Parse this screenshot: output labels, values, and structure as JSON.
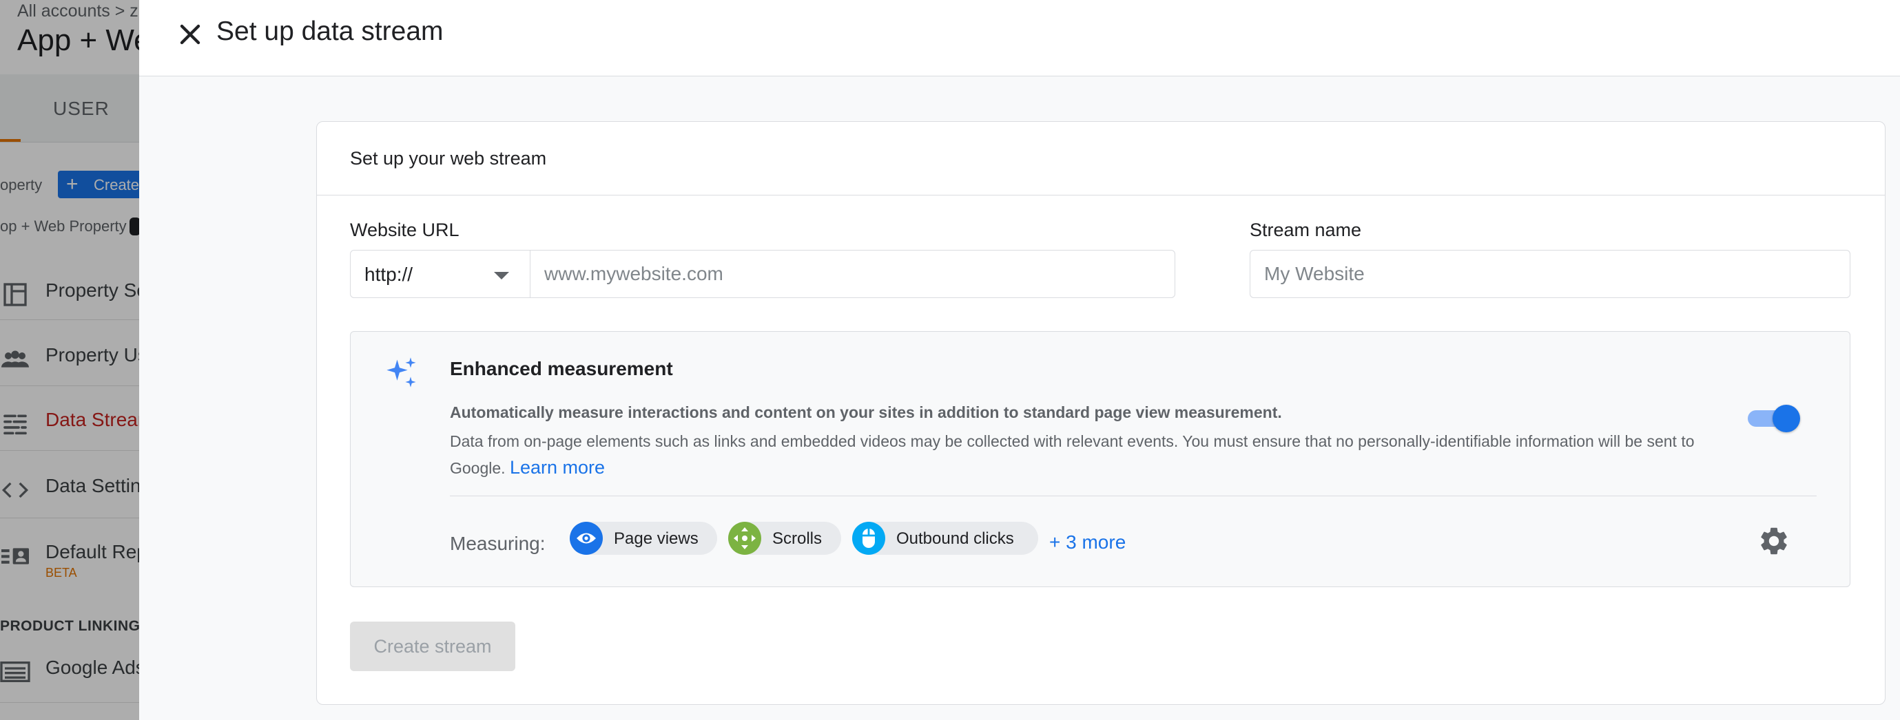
{
  "background": {
    "breadcrumb": "All accounts > z",
    "page_title": "App + We",
    "tab_label": "USER",
    "property_label": "operty",
    "create_label": "Create",
    "property_name": "op + Web Property",
    "nav_items": [
      {
        "label": "Property Se",
        "icon": "layout-icon",
        "active": false
      },
      {
        "label": "Property Us",
        "icon": "people-icon",
        "active": false
      },
      {
        "label": "Data Stream",
        "icon": "data-streams-icon",
        "active": true
      },
      {
        "label": "Data Setting",
        "icon": "code-icon",
        "active": false
      },
      {
        "label": "Default Rep",
        "icon": "id-card-icon",
        "active": false,
        "badge": "BETA"
      }
    ],
    "section_label": "PRODUCT LINKING",
    "linking_items": [
      {
        "label": "Google Ads",
        "icon": "google-ads-icon"
      }
    ]
  },
  "dialog": {
    "title": "Set up data stream",
    "close_icon": "close-icon"
  },
  "card": {
    "title": "Set up your web stream",
    "website_url_label": "Website URL",
    "protocol_value": "http://",
    "url_placeholder": "www.mywebsite.com",
    "stream_name_label": "Stream name",
    "stream_name_placeholder": "My Website"
  },
  "enhanced": {
    "icon": "sparkle-icon",
    "title": "Enhanced measurement",
    "description_bold": "Automatically measure interactions and content on your sites in addition to standard page view measurement.",
    "description": "Data from on-page elements such as links and embedded videos may be collected with relevant events. You must ensure that no personally-identifiable information will be sent to Google.",
    "learn_more": "Learn more",
    "enabled": true,
    "measuring_label": "Measuring:",
    "chips": [
      {
        "label": "Page views",
        "icon": "eye-icon",
        "color": "#1a73e8"
      },
      {
        "label": "Scrolls",
        "icon": "move-arrows-icon",
        "color": "#7cb342"
      },
      {
        "label": "Outbound clicks",
        "icon": "mouse-icon",
        "color": "#03a9f4"
      }
    ],
    "more_label": "+ 3 more",
    "settings_icon": "gear-icon"
  },
  "actions": {
    "create_stream_label": "Create stream"
  },
  "colors": {
    "accent": "#1a73e8",
    "active_nav": "#c5221f",
    "beta": "#e37400"
  }
}
